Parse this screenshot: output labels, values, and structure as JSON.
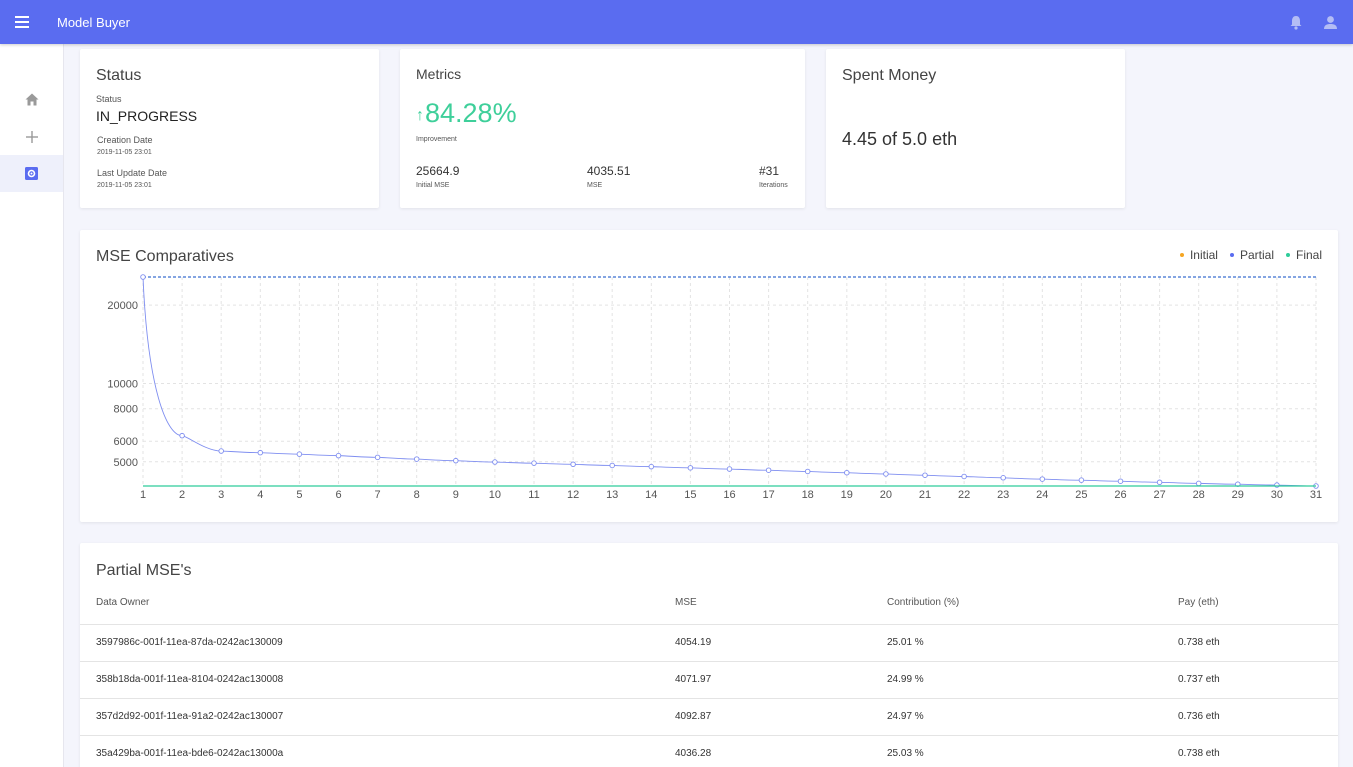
{
  "app": {
    "title": "Model Buyer"
  },
  "icons": {
    "menu": "menu-icon",
    "bell": "bell-icon",
    "user": "account-icon",
    "home": "home-icon",
    "add": "plus-icon",
    "model": "gear-box-icon"
  },
  "colors": {
    "appbar": "#5a6cf0",
    "improvement": "#3ecf9a",
    "initial": "#f5a623",
    "partial": "#5a6cf0",
    "final": "#2ecc9a"
  },
  "status_card": {
    "title": "Status",
    "status_label": "Status",
    "status_value": "IN_PROGRESS",
    "creation_label": "Creation Date",
    "creation_value": "2019-11-05 23:01",
    "update_label": "Last Update Date",
    "update_value": "2019-11-05 23:01"
  },
  "metrics_card": {
    "title": "Metrics",
    "arrow": "↑",
    "improvement_value": "84.28%",
    "improvement_label": "Improvement",
    "initial_mse_value": "25664.9",
    "initial_mse_label": "Initial MSE",
    "mse_value": "4035.51",
    "mse_label": "MSE",
    "iterations_value": "#31",
    "iterations_label": "Iterations"
  },
  "money_card": {
    "title": "Spent Money",
    "value": "4.45 of 5.0 eth"
  },
  "chart_data": {
    "type": "line",
    "title": "MSE Comparatives",
    "x": [
      1,
      2,
      3,
      4,
      5,
      6,
      7,
      8,
      9,
      10,
      11,
      12,
      13,
      14,
      15,
      16,
      17,
      18,
      19,
      20,
      21,
      22,
      23,
      24,
      25,
      26,
      27,
      28,
      29,
      30,
      31
    ],
    "series": [
      {
        "name": "Initial",
        "values": [
          25664.9,
          25664.9,
          25664.9,
          25664.9,
          25664.9,
          25664.9,
          25664.9,
          25664.9,
          25664.9,
          25664.9,
          25664.9,
          25664.9,
          25664.9,
          25664.9,
          25664.9,
          25664.9,
          25664.9,
          25664.9,
          25664.9,
          25664.9,
          25664.9,
          25664.9,
          25664.9,
          25664.9,
          25664.9,
          25664.9,
          25664.9,
          25664.9,
          25664.9,
          25664.9,
          25664.9
        ]
      },
      {
        "name": "Partial",
        "values": [
          25664.9,
          6300,
          5500,
          5420,
          5350,
          5280,
          5200,
          5120,
          5050,
          4990,
          4940,
          4890,
          4840,
          4790,
          4740,
          4690,
          4640,
          4590,
          4540,
          4490,
          4440,
          4390,
          4340,
          4290,
          4250,
          4210,
          4170,
          4130,
          4100,
          4070,
          4035.51
        ]
      },
      {
        "name": "Final",
        "values": [
          4035.51,
          4035.51,
          4035.51,
          4035.51,
          4035.51,
          4035.51,
          4035.51,
          4035.51,
          4035.51,
          4035.51,
          4035.51,
          4035.51,
          4035.51,
          4035.51,
          4035.51,
          4035.51,
          4035.51,
          4035.51,
          4035.51,
          4035.51,
          4035.51,
          4035.51,
          4035.51,
          4035.51,
          4035.51,
          4035.51,
          4035.51,
          4035.51,
          4035.51,
          4035.51,
          4035.51
        ]
      }
    ],
    "yticks": [
      5000,
      6000,
      8000,
      10000,
      20000
    ],
    "ytick_labels": [
      "5000",
      "6000",
      "8000",
      "10000",
      "20000"
    ],
    "ylim": [
      4035.51,
      25664.9
    ],
    "yscale": "log",
    "grid": true,
    "legend": "top-right"
  },
  "partial_table": {
    "title": "Partial MSE's",
    "headers": [
      "Data Owner",
      "MSE",
      "Contribution (%)",
      "Pay (eth)"
    ],
    "rows": [
      [
        "3597986c-001f-11ea-87da-0242ac130009",
        "4054.19",
        "25.01 %",
        "0.738 eth"
      ],
      [
        "358b18da-001f-11ea-8104-0242ac130008",
        "4071.97",
        "24.99 %",
        "0.737 eth"
      ],
      [
        "357d2d92-001f-11ea-91a2-0242ac130007",
        "4092.87",
        "24.97 %",
        "0.736 eth"
      ],
      [
        "35a429ba-001f-11ea-bde6-0242ac13000a",
        "4036.28",
        "25.03 %",
        "0.738 eth"
      ]
    ]
  }
}
